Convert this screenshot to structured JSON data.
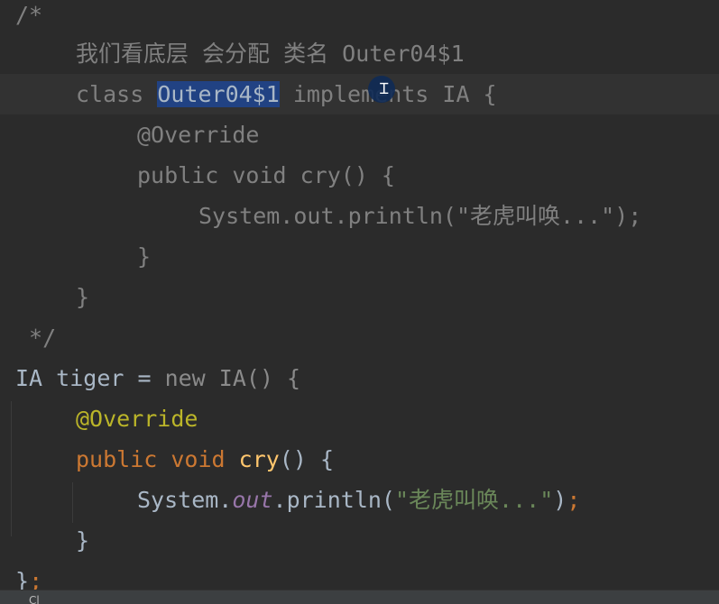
{
  "code": {
    "l1": "/*",
    "l2": "我们看底层 会分配 类名 Outer04$1",
    "l3_pre": "class ",
    "l3_sel": "Outer04$1",
    "l3_post": " implements IA {",
    "l4": "@Override",
    "l5": "public void cry() {",
    "l6": "System.out.println(\"老虎叫唤...\");",
    "l7": "}",
    "l8": "}",
    "l9": " */",
    "l10_type": "IA",
    "l10_var": " tiger = ",
    "l10_new": "new",
    "l10_rest": " IA() {",
    "l11": "@Override",
    "l12_kw": "public void",
    "l12_name": "cry",
    "l12_rest": "() {",
    "l13_sys": "System.",
    "l13_out": "out",
    "l13_call": ".println(",
    "l13_str": "\"老虎叫唤...\"",
    "l13_close": ")",
    "l13_semi": ";",
    "l14": "}",
    "l15_brace": "}",
    "l15_semi": ";"
  },
  "status": {
    "partial": "Cl"
  },
  "colors": {
    "background": "#2b2b2b",
    "current_line": "#323232",
    "comment": "#808080",
    "keyword": "#cc7832",
    "annotation": "#bbb529",
    "method": "#ffc66d",
    "string": "#6a8759",
    "static_field": "#9876aa",
    "selection": "#214283"
  },
  "icons": {
    "cursor": "text-cursor-icon"
  }
}
